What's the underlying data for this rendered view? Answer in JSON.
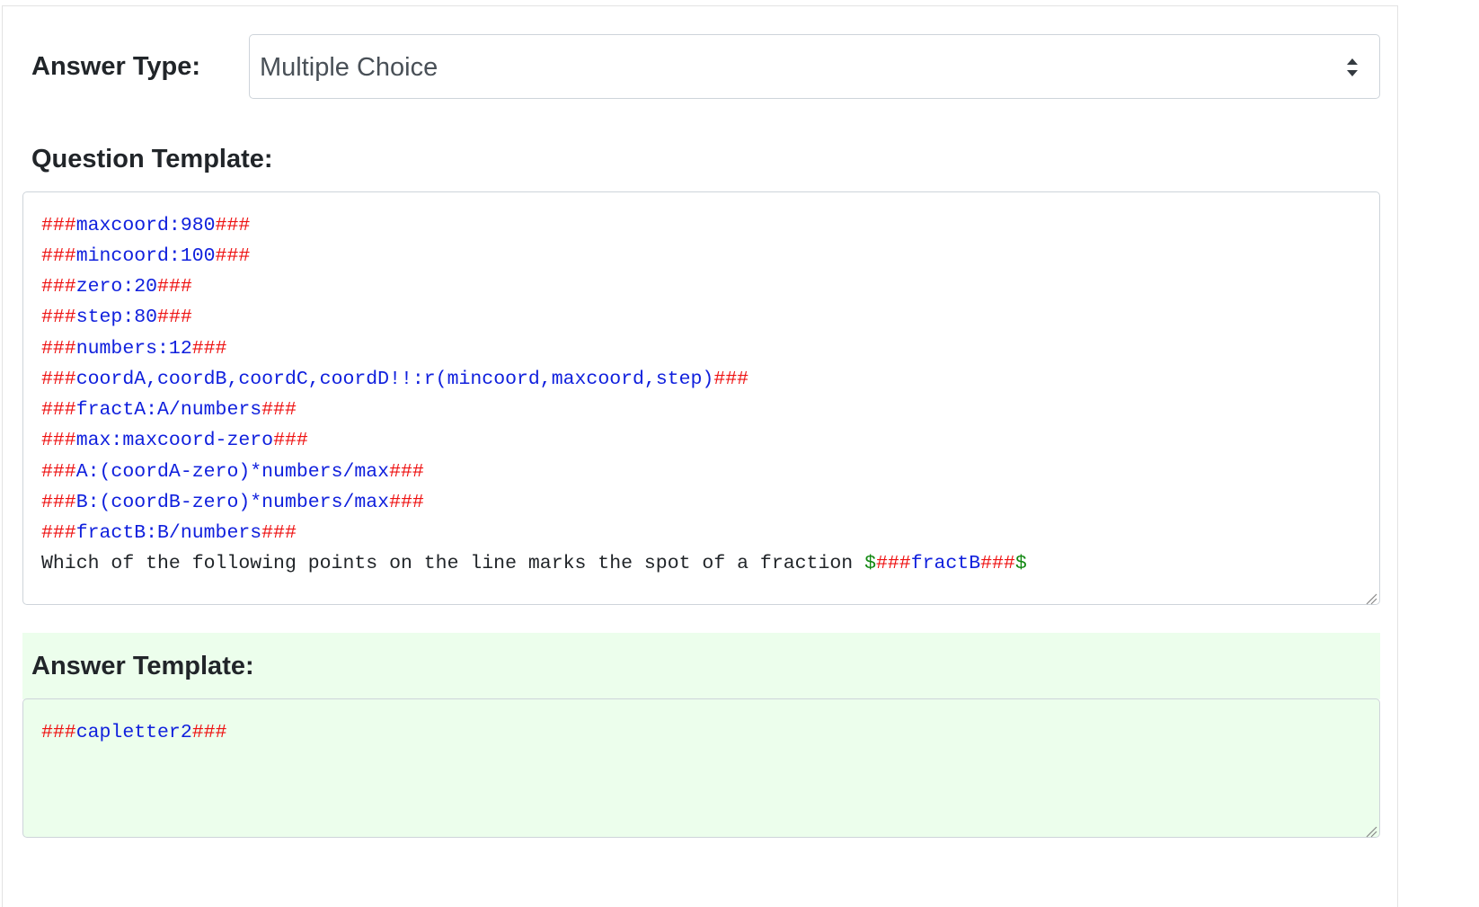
{
  "answer_type": {
    "label": "Answer Type:",
    "selected": "Multiple Choice"
  },
  "question_template": {
    "label": "Question Template:",
    "lines": [
      {
        "mark_start": "###",
        "body": "maxcoord:980",
        "mark_end": "###"
      },
      {
        "mark_start": "###",
        "body": "mincoord:100",
        "mark_end": "###"
      },
      {
        "mark_start": "###",
        "body": "zero:20",
        "mark_end": "###"
      },
      {
        "mark_start": "###",
        "body": "step:80",
        "mark_end": "###"
      },
      {
        "mark_start": "###",
        "body": "numbers:12",
        "mark_end": "###"
      },
      {
        "mark_start": "###",
        "body": "coordA,coordB,coordC,coordD!!:r(mincoord,maxcoord,step)",
        "mark_end": "###"
      },
      {
        "mark_start": "###",
        "body": "fractA:A/numbers",
        "mark_end": "###"
      },
      {
        "mark_start": "###",
        "body": "max:maxcoord-zero",
        "mark_end": "###"
      },
      {
        "mark_start": "###",
        "body": "A:(coordA-zero)*numbers/max",
        "mark_end": "###"
      },
      {
        "mark_start": "###",
        "body": "B:(coordB-zero)*numbers/max",
        "mark_end": "###"
      },
      {
        "mark_start": "###",
        "body": "fractB:B/numbers",
        "mark_end": "###"
      }
    ],
    "last_line": {
      "text": "Which of the following points on the line marks the spot of a fraction ",
      "dollar_open": "$",
      "mark_start": "###",
      "body": "fractB",
      "mark_end": "###",
      "dollar_close": "$"
    }
  },
  "answer_template": {
    "label": "Answer Template:",
    "line": {
      "mark_start": "###",
      "body": "capletter2",
      "mark_end": "###"
    }
  },
  "colors": {
    "marker": "#ee1111",
    "variable": "#1020dd",
    "math_delimiter": "#118811",
    "answer_background": "#ecfeec"
  },
  "icons": {
    "select_arrows": "sort-arrows-icon",
    "resize_handle": "resize-grip-icon"
  }
}
